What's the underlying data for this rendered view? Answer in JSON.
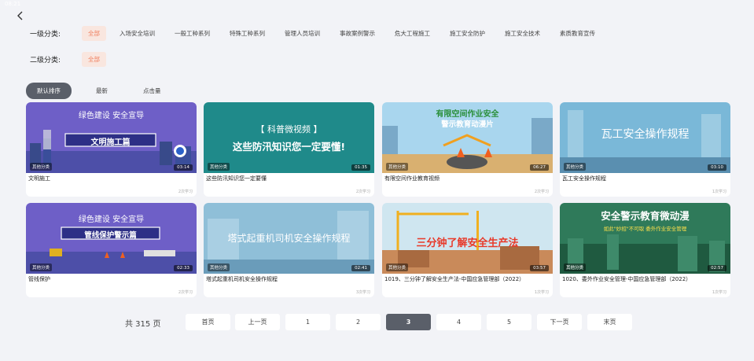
{
  "status_bar": {
    "time": "08:21",
    "right": ""
  },
  "filters": {
    "level1": {
      "label": "一级分类:",
      "options": [
        "全部",
        "入场安全培训",
        "一般工种系列",
        "特殊工种系列",
        "管理人员培训",
        "事故案例警示",
        "危大工程施工",
        "施工安全防护",
        "施工安全技术",
        "素质教育宣传"
      ]
    },
    "level2": {
      "label": "二级分类:",
      "options": [
        "全部"
      ]
    }
  },
  "sort": [
    "默认排序",
    "最新",
    "点击量"
  ],
  "videos": [
    {
      "title": "文明施工",
      "category": "其他分类",
      "duration": "03:14",
      "views": "2次学习",
      "thumb_text": [
        "绿色建设 安全宣导",
        "文明施工篇"
      ],
      "thumb_bg": "#6e5fc7"
    },
    {
      "title": "这些防汛知识您一定要懂",
      "category": "其他分类",
      "duration": "01:35",
      "views": "2次学习",
      "thumb_text": [
        "【 科普微视频 】",
        "这些防汛知识您一定要懂!"
      ],
      "thumb_bg": "#1f8a8a"
    },
    {
      "title": "有限空间作业教育视频",
      "category": "其他分类",
      "duration": "06:27",
      "views": "2次学习",
      "thumb_text": [
        "有限空间作业安全",
        "警示教育动漫片"
      ],
      "thumb_bg": "#a9d6ee"
    },
    {
      "title": "瓦工安全操作规程",
      "category": "其他分类",
      "duration": "03:10",
      "views": "1次学习",
      "thumb_text": [
        "瓦工安全操作规程"
      ],
      "thumb_bg": "#7ab8d8"
    },
    {
      "title": "管线保护",
      "category": "其他分类",
      "duration": "02:33",
      "views": "2次学习",
      "thumb_text": [
        "绿色建设 安全宣导",
        "管线保护警示篇"
      ],
      "thumb_bg": "#6e5fc7"
    },
    {
      "title": "塔式起重机司机安全操作规程",
      "category": "其他分类",
      "duration": "02:41",
      "views": "3次学习",
      "thumb_text": [
        "塔式起重机司机安全操作规程"
      ],
      "thumb_bg": "#8fbfd8"
    },
    {
      "title": "1019、三分钟了解安全生产法-中国应急管理部（2022）",
      "category": "其他分类",
      "duration": "03:57",
      "views": "1次学习",
      "thumb_text": [
        "三分钟了解安全生产法"
      ],
      "thumb_bg": "#cfe6f0"
    },
    {
      "title": "1020、委外作业安全管理-中国应急管理部（2022）",
      "category": "其他分类",
      "duration": "02:57",
      "views": "1次学习",
      "thumb_text": [
        "安全警示教育微动漫",
        "如此\"妙招\"不可取 委外作业安全管理"
      ],
      "thumb_bg": "#2f7a5a"
    }
  ],
  "pagination": {
    "total": "共 315 页",
    "first": "首页",
    "prev": "上一页",
    "pages": [
      "1",
      "2",
      "3",
      "4",
      "5"
    ],
    "current": "3",
    "next": "下一页",
    "last": "末页"
  }
}
